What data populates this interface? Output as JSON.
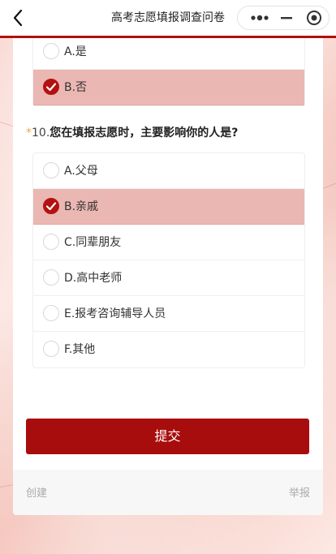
{
  "nav": {
    "title": "高考志愿填报调查问卷"
  },
  "question_prev": {
    "options": [
      {
        "label": "A.是",
        "selected": false
      },
      {
        "label": "B.否",
        "selected": true
      }
    ]
  },
  "question": {
    "required_mark": "*",
    "number": "10.",
    "text": "您在填报志愿时，主要影响你的人是?",
    "options": [
      {
        "label": "A.父母",
        "selected": false
      },
      {
        "label": "B.亲戚",
        "selected": true
      },
      {
        "label": "C.同辈朋友",
        "selected": false
      },
      {
        "label": "D.高中老师",
        "selected": false
      },
      {
        "label": "E.报考咨询辅导人员",
        "selected": false
      },
      {
        "label": "F.其他",
        "selected": false
      }
    ]
  },
  "submit_label": "提交",
  "footer": {
    "left": "创建",
    "right": "举报"
  },
  "colors": {
    "accent": "#b31212",
    "selected_bg": "#ebb7b3",
    "required_star": "#f4a63a"
  },
  "icons": [
    "back-arrow-icon",
    "more-dots-icon",
    "minimize-icon",
    "close-target-icon",
    "checkmark-icon"
  ]
}
